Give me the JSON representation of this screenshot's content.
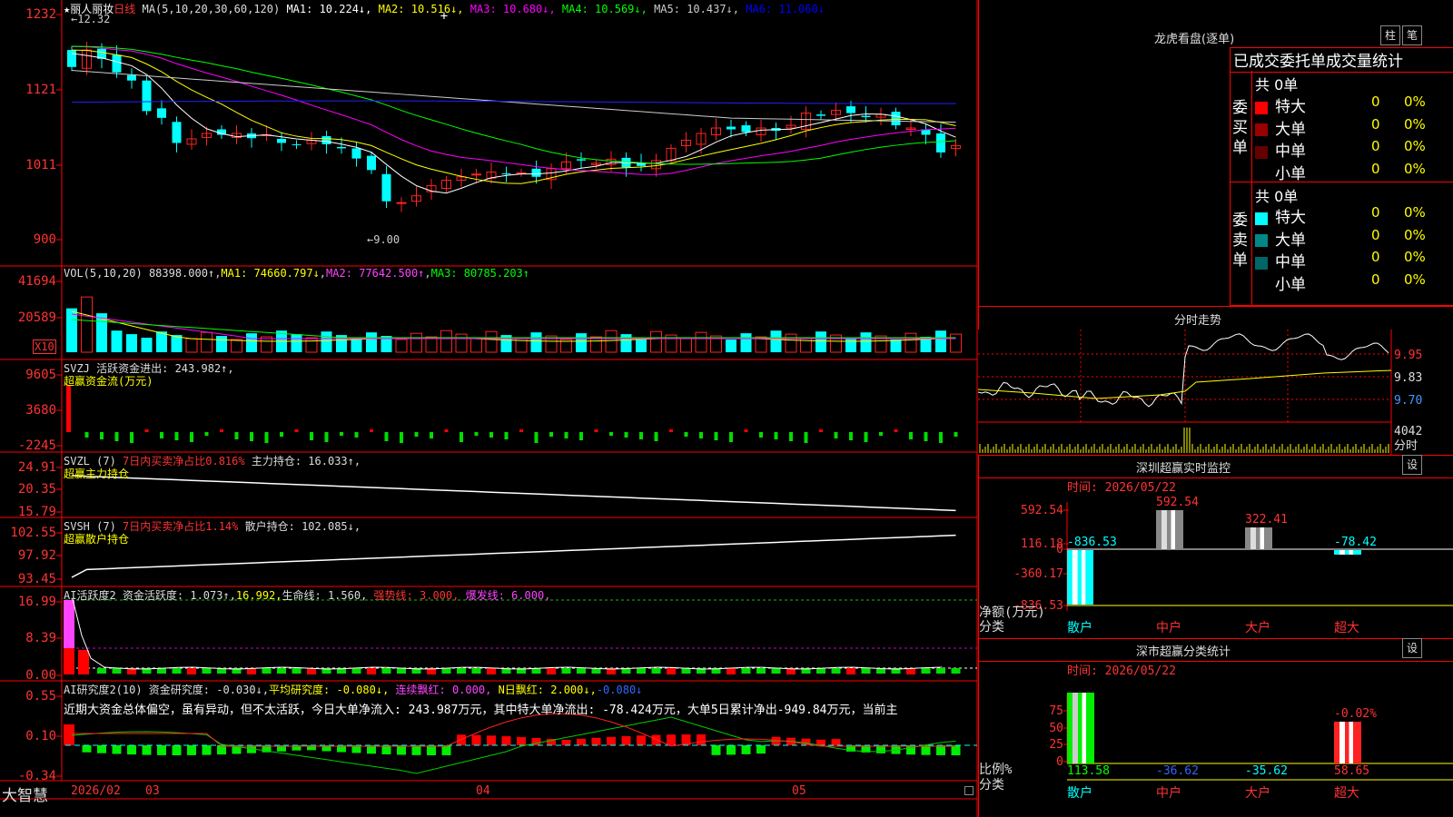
{
  "stock": {
    "name": "丽人丽妆",
    "period": "日线",
    "ma_label": "MA(5,10,20,30,60,120)",
    "ma": [
      {
        "label": "MA1: 10.224↓",
        "color": "#ffffff"
      },
      {
        "label": "MA2: 10.516↓",
        "color": "#ffff00"
      },
      {
        "label": "MA3: 10.680↓",
        "color": "#ff00ff"
      },
      {
        "label": "MA4: 10.569↓",
        "color": "#00ff00"
      },
      {
        "label": "MA5: 10.437↓",
        "color": "#cccccc"
      },
      {
        "label": "MA6: 11.060↓",
        "color": "#0000ff"
      }
    ],
    "high_note": "12.32",
    "low_note": "9.00"
  },
  "price_axis": [
    "1232",
    "1121",
    "1011",
    "900"
  ],
  "vol": {
    "header": "VOL(5,10,20)",
    "value": "88398.000↑",
    "ma1": "MA1: 74660.797↓",
    "ma2": "MA2: 77642.500↑",
    "ma3": "MA3: 80785.203↑",
    "axis": [
      "41694",
      "20589"
    ],
    "unit": "X10"
  },
  "svzj": {
    "header": "SVZJ  活跃资金进出: 243.982↑,",
    "sub": "超赢资金流(万元)",
    "axis": [
      "9605",
      "3680",
      "-2245"
    ]
  },
  "svzl": {
    "header_a": "SVZL (7)",
    "header_b": "7日内买卖净占比0.816%",
    "header_c": "主力持仓: 16.033↑,",
    "sub": "超赢主力持仓",
    "axis": [
      "24.91",
      "20.35",
      "15.79"
    ]
  },
  "svsh": {
    "header_a": "SVSH (7)",
    "header_b": "7日内买卖净占比1.14%",
    "header_c": "散户持仓: 102.085↓,",
    "sub": "超赢散户持仓",
    "axis": [
      "102.55",
      "97.92",
      "93.45"
    ]
  },
  "ai1": {
    "header_a": "AI活跃度2 资金活跃度: 1.073↑,",
    "header_b": "16.992,",
    "header_c": "生命线: 1.560,",
    "header_d": "强势线: 3.000,",
    "header_e": "爆发线: 6.000,",
    "axis": [
      "16.99",
      "8.39",
      "0.00"
    ]
  },
  "ai2": {
    "header_a": "AI研究度2(10) 资金研究度: -0.030↓,",
    "header_b": "平均研究度: -0.080↓,",
    "header_c": "连续飘红: 0.000,",
    "header_d": "N日飘红: 2.000↓,",
    "header_e": "-0.080↓",
    "text": "近期大资金总体偏空，虽有异动，但不太活跃，今日大单净流入: 243.987万元，其中特大单净流出: -78.424万元，大单5日累计净出-949.84万元，当前主",
    "axis": [
      "0.55",
      "0.10",
      "-0.34"
    ]
  },
  "dates": {
    "brand": "大智慧",
    "d0": "2026/02",
    "d1": "03",
    "d2": "04",
    "d3": "05"
  },
  "lhkp": {
    "title": "龙虎看盘(逐单)",
    "btn1": "柱",
    "btn2": "笔",
    "tabs": "已成交委托单成交量统计",
    "buy_label": "委买单",
    "sell_label": "委卖单",
    "buy_total": "共 0单",
    "sell_total": "共 0单",
    "buy": [
      {
        "name": "特大",
        "count": "0",
        "pct": "0%",
        "color": "#ff0000"
      },
      {
        "name": "大单",
        "count": "0",
        "pct": "0%",
        "color": "#990000"
      },
      {
        "name": "中单",
        "count": "0",
        "pct": "0%",
        "color": "#660000"
      },
      {
        "name": "小单",
        "count": "0",
        "pct": "0%",
        "color": "#000000"
      }
    ],
    "sell": [
      {
        "name": "特大",
        "count": "0",
        "pct": "0%",
        "color": "#00ffff"
      },
      {
        "name": "大单",
        "count": "0",
        "pct": "0%",
        "color": "#008888"
      },
      {
        "name": "中单",
        "count": "0",
        "pct": "0%",
        "color": "#006666"
      },
      {
        "name": "小单",
        "count": "0",
        "pct": "0%",
        "color": "#000000"
      }
    ]
  },
  "fenshi": {
    "title": "分时走势",
    "axis": [
      "9.95",
      "9.83",
      "9.70"
    ],
    "vol_axis": [
      "4042",
      "分时"
    ]
  },
  "szmon": {
    "title": "深圳超赢实时监控",
    "btn": "设",
    "time": "时间: 2026/05/22",
    "axis": [
      "592.54",
      "116.18",
      "0",
      "-360.17",
      "-836.53"
    ],
    "labels": {
      "sanhu": "-836.53",
      "zhonghu": "592.54",
      "dahu": "322.41",
      "chaoda": "-78.42"
    },
    "unit": "净额(万元)",
    "cat": "分类",
    "cats": [
      "散户",
      "中户",
      "大户",
      "超大"
    ]
  },
  "fenlei": {
    "title": "深市超赢分类统计",
    "btn": "设",
    "time": "时间: 2026/05/22",
    "axis": [
      "75",
      "50",
      "25",
      "0"
    ],
    "top_label": "-0.02%",
    "vals": [
      "113.58",
      "-36.62",
      "-35.62",
      "58.65"
    ],
    "unit": "比例%",
    "cat": "分类",
    "cats": [
      "散户",
      "中户",
      "大户",
      "超大"
    ]
  }
}
